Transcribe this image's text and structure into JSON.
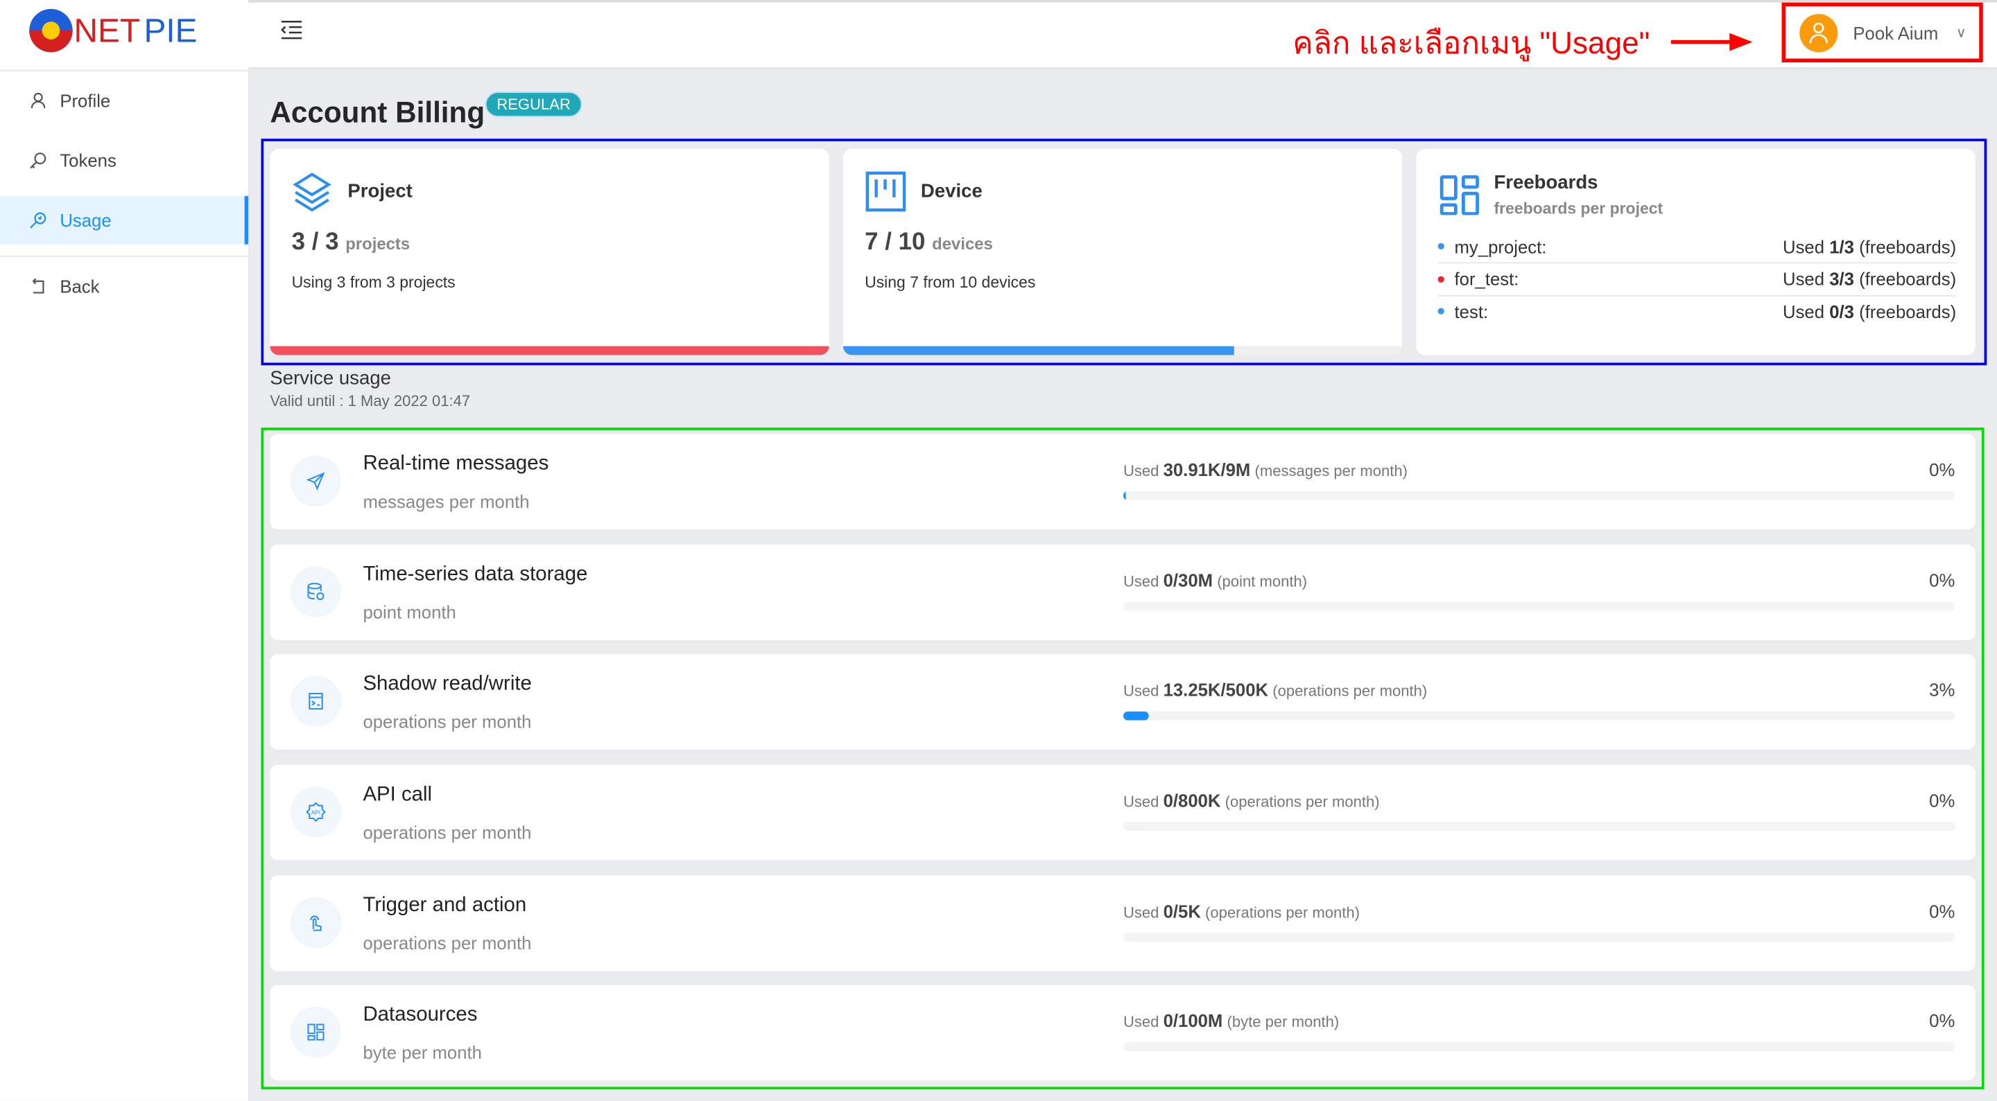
{
  "logo": {
    "text": "NETPIE"
  },
  "sidebar": {
    "items": [
      {
        "label": "Profile",
        "icon": "user-icon"
      },
      {
        "label": "Tokens",
        "icon": "key-icon"
      },
      {
        "label": "Usage",
        "icon": "usage-icon",
        "active": true
      },
      {
        "label": "Back",
        "icon": "back-icon"
      }
    ]
  },
  "header": {
    "annotation": "คลิก และเลือกเมนู \"Usage\"",
    "user_name": "Pook Aium",
    "avatar_color": "#fa9b0c"
  },
  "page": {
    "title": "Account Billing",
    "badge": "REGULAR"
  },
  "cards": {
    "project": {
      "title": "Project",
      "used": "3",
      "limit": "3",
      "unit": "projects",
      "using": "Using 3 from 3 projects",
      "percent": 100,
      "bar_color": "#f0515f"
    },
    "device": {
      "title": "Device",
      "used": "7",
      "limit": "10",
      "unit": "devices",
      "using": "Using 7 from 10 devices",
      "percent": 70,
      "bar_color": "#3a95f0"
    },
    "freeboards": {
      "title": "Freeboards",
      "subtitle": "freeboards per project",
      "rows": [
        {
          "name": "my_project:",
          "used_label": "Used",
          "value": "1/3",
          "unit": "(freeboards)",
          "dot": "#3a95f0"
        },
        {
          "name": "for_test:",
          "used_label": "Used",
          "value": "3/3",
          "unit": "(freeboards)",
          "dot": "#f5222d"
        },
        {
          "name": "test:",
          "used_label": "Used",
          "value": "0/3",
          "unit": "(freeboards)",
          "dot": "#3a95f0"
        }
      ]
    }
  },
  "service": {
    "title": "Service usage",
    "valid": "Valid until : 1 May 2022 01:47",
    "rows": [
      {
        "title": "Real-time messages",
        "subtitle": "messages per month",
        "used_label": "Used",
        "value": "30.91K/9M",
        "unit": "(messages per month)",
        "percent_label": "0%",
        "percent": 0.3,
        "icon": "send-icon"
      },
      {
        "title": "Time-series data storage",
        "subtitle": "point month",
        "used_label": "Used",
        "value": "0/30M",
        "unit": "(point month)",
        "percent_label": "0%",
        "percent": 0,
        "icon": "database-icon"
      },
      {
        "title": "Shadow read/write",
        "subtitle": "operations per month",
        "used_label": "Used",
        "value": "13.25K/500K",
        "unit": "(operations per month)",
        "percent_label": "3%",
        "percent": 3,
        "icon": "terminal-icon"
      },
      {
        "title": "API call",
        "subtitle": "operations per month",
        "used_label": "Used",
        "value": "0/800K",
        "unit": "(operations per month)",
        "percent_label": "0%",
        "percent": 0,
        "icon": "api-icon"
      },
      {
        "title": "Trigger and action",
        "subtitle": "operations per month",
        "used_label": "Used",
        "value": "0/5K",
        "unit": "(operations per month)",
        "percent_label": "0%",
        "percent": 0,
        "icon": "touch-icon"
      },
      {
        "title": "Datasources",
        "subtitle": "byte per month",
        "used_label": "Used",
        "value": "0/100M",
        "unit": "(byte per month)",
        "percent_label": "0%",
        "percent": 0,
        "icon": "dashboard-icon"
      }
    ]
  }
}
